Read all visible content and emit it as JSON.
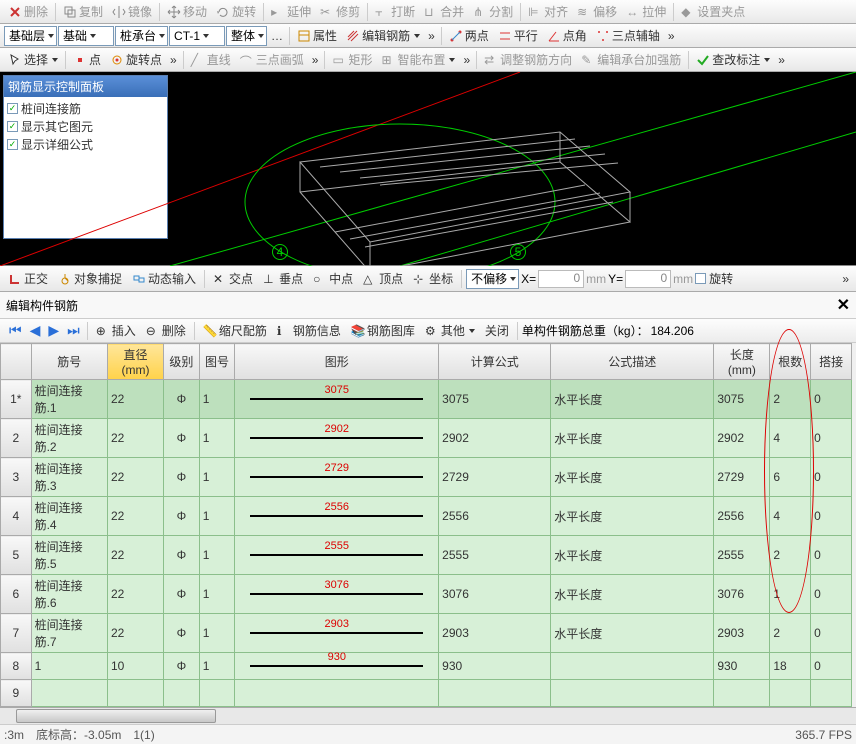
{
  "toolbar1": {
    "delete": "删除",
    "copy": "复制",
    "mirror": "镜像",
    "move": "移动",
    "rotate": "旋转",
    "extend": "延伸",
    "trim": "修剪",
    "break": "打断",
    "merge": "合并",
    "split": "分割",
    "align": "对齐",
    "offset": "偏移",
    "stretch": "拉伸",
    "setgrip": "设置夹点"
  },
  "toolbar2": {
    "layer": "基础层",
    "category": "基础",
    "element": "桩承台",
    "code": "CT-1",
    "mode": "整体",
    "props": "属性",
    "edit_rebar": "编辑钢筋",
    "two_pt": "两点",
    "parallel": "平行",
    "pt_angle": "点角",
    "three_pt": "三点辅轴"
  },
  "toolbar3": {
    "select": "选择",
    "point": "点",
    "rotpoint": "旋转点",
    "line": "直线",
    "arc3": "三点画弧",
    "rect": "矩形",
    "smart": "智能布置",
    "adjrebar": "调整钢筋方向",
    "editcap": "编辑承台加强筋",
    "viewmark": "查改标注"
  },
  "panel": {
    "title": "钢筋显示控制面板",
    "c1": "桩间连接筋",
    "c2": "显示其它图元",
    "c3": "显示详细公式"
  },
  "axis": {
    "a4": "4",
    "a5": "5"
  },
  "snap": {
    "ortho": "正交",
    "osnap": "对象捕捉",
    "dyninput": "动态输入",
    "inters": "交点",
    "perp": "垂点",
    "mid": "中点",
    "apex": "顶点",
    "coord": "坐标",
    "nooffset": "不偏移",
    "x": "X=",
    "y": "Y=",
    "mm": "mm",
    "rot": "旋转",
    "z0": "0"
  },
  "section": {
    "title": "编辑构件钢筋"
  },
  "tools": {
    "insert": "插入",
    "delete": "删除",
    "scale": "缩尺配筋",
    "info": "钢筋信息",
    "lib": "钢筋图库",
    "other": "其他",
    "close": "关闭",
    "weight_lbl": "单构件钢筋总重（kg）：",
    "weight_val": "184.206"
  },
  "cols": {
    "c1": "筋号",
    "c2": "直径(mm)",
    "c3": "级别",
    "c4": "图号",
    "c5": "图形",
    "c6": "计算公式",
    "c7": "公式描述",
    "c8": "长度(mm)",
    "c9": "根数",
    "c10": "搭接"
  },
  "rows": [
    {
      "n": "1*",
      "name": "桩间连接筋.1",
      "dia": "22",
      "grade": "Φ",
      "code": "1",
      "shape": "3075",
      "calc": "3075",
      "desc": "水平长度",
      "len": "3075",
      "cnt": "2",
      "lap": "0"
    },
    {
      "n": "2",
      "name": "桩间连接筋.2",
      "dia": "22",
      "grade": "Φ",
      "code": "1",
      "shape": "2902",
      "calc": "2902",
      "desc": "水平长度",
      "len": "2902",
      "cnt": "4",
      "lap": "0"
    },
    {
      "n": "3",
      "name": "桩间连接筋.3",
      "dia": "22",
      "grade": "Φ",
      "code": "1",
      "shape": "2729",
      "calc": "2729",
      "desc": "水平长度",
      "len": "2729",
      "cnt": "6",
      "lap": "0"
    },
    {
      "n": "4",
      "name": "桩间连接筋.4",
      "dia": "22",
      "grade": "Φ",
      "code": "1",
      "shape": "2556",
      "calc": "2556",
      "desc": "水平长度",
      "len": "2556",
      "cnt": "4",
      "lap": "0"
    },
    {
      "n": "5",
      "name": "桩间连接筋.5",
      "dia": "22",
      "grade": "Φ",
      "code": "1",
      "shape": "2555",
      "calc": "2555",
      "desc": "水平长度",
      "len": "2555",
      "cnt": "2",
      "lap": "0"
    },
    {
      "n": "6",
      "name": "桩间连接筋.6",
      "dia": "22",
      "grade": "Φ",
      "code": "1",
      "shape": "3076",
      "calc": "3076",
      "desc": "水平长度",
      "len": "3076",
      "cnt": "1",
      "lap": "0"
    },
    {
      "n": "7",
      "name": "桩间连接筋.7",
      "dia": "22",
      "grade": "Φ",
      "code": "1",
      "shape": "2903",
      "calc": "2903",
      "desc": "水平长度",
      "len": "2903",
      "cnt": "2",
      "lap": "0"
    },
    {
      "n": "8",
      "name": "1",
      "dia": "10",
      "grade": "Φ",
      "code": "1",
      "shape": "930",
      "calc": "930",
      "desc": "",
      "len": "930",
      "cnt": "18",
      "lap": "0"
    }
  ],
  "status": {
    "s1": ":3m",
    "s2": "底标高：-3.05m",
    "s3": "1(1)",
    "s4": "365.7 FPS"
  }
}
